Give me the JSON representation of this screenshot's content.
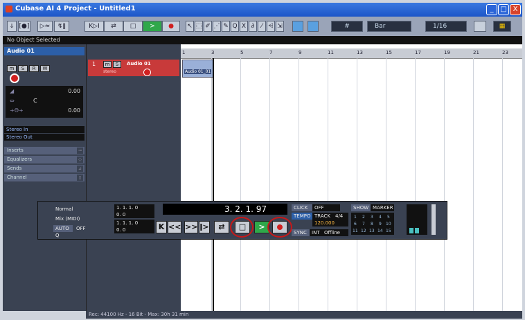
{
  "window": {
    "title": "Cubase AI 4 Project - Untitled1",
    "min": "_",
    "max": "□",
    "close": "X"
  },
  "toolbar": {
    "buttons": [
      "ↆ",
      "[●]",
      "▷≈",
      "↯ǁ",
      "K▷I",
      "⇄",
      "□",
      ">",
      "●"
    ],
    "tools": [
      "↖",
      "⬚",
      "✐",
      "⋰",
      "✎",
      "Q",
      "X",
      "∂",
      "⁄",
      "⩤",
      "⇲"
    ],
    "snap": "Bar",
    "quantize": "1/16",
    "grid_icon": "#",
    "color_icon": "▦"
  },
  "status": {
    "text": "No Object Selected"
  },
  "inspector": {
    "track_name": "Audio 01",
    "buttons": [
      "m",
      "S",
      "R",
      "W"
    ],
    "volume": "0.00",
    "pan": "C",
    "delay": "0.00",
    "input": "Stereo In",
    "output": "Stereo Out",
    "sections": [
      "Inserts",
      "Equalizers",
      "Sends",
      "Channel"
    ]
  },
  "track": {
    "number": "1",
    "name": "Audio 01",
    "mode": "stereo",
    "buttons": [
      "m",
      "S"
    ]
  },
  "ruler": {
    "bars": [
      "1",
      "3",
      "5",
      "7",
      "9",
      "11",
      "13",
      "15",
      "17",
      "19",
      "21",
      "23"
    ]
  },
  "event": {
    "label": "Audio 01_01"
  },
  "transport": {
    "mode": "Normal",
    "mix": "Mix (MIDI)",
    "auto_label": "AUTO Q",
    "auto_value": "OFF",
    "left_locator": "1. 1. 1. 0",
    "right_locator": "1. 1. 1. 0",
    "left_sub": "0. 0",
    "right_sub": "0. 0",
    "position": "3. 2. 1. 97",
    "click_label": "CLICK",
    "click_value": "OFF",
    "tempo_label": "TEMPO",
    "track_label": "TRACK",
    "signature": "4/4",
    "tempo_value": "120.000",
    "sync_label": "SYNC",
    "int_label": "INT",
    "offline": "Offline",
    "show_label": "SHOW",
    "marker_label": "MARKER",
    "markers": [
      "1",
      "2",
      "3",
      "4",
      "5",
      "6",
      "7",
      "8",
      "9",
      "10",
      "11",
      "12",
      "13",
      "14",
      "15"
    ],
    "buttons": [
      "K",
      "<<",
      ">>",
      "ǀ>",
      "⇄",
      "□",
      ">",
      "●"
    ]
  },
  "footer": {
    "text": "Rec: 44100 Hz - 16 Bit - Max: 30h 31 min"
  }
}
